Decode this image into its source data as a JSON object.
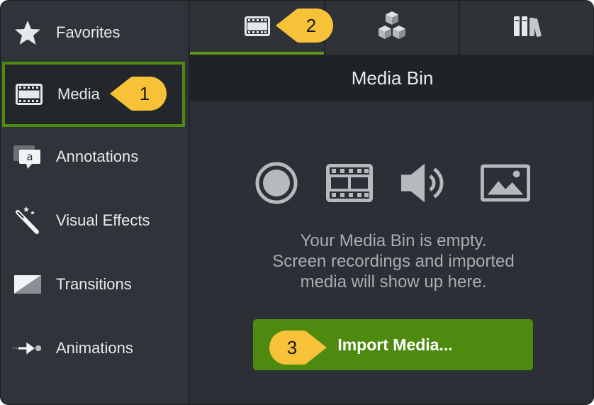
{
  "sidebar": {
    "items": [
      {
        "label": "Favorites",
        "icon": "star-icon"
      },
      {
        "label": "Media",
        "icon": "film-icon",
        "selected": true
      },
      {
        "label": "Annotations",
        "icon": "annotation-bubble-icon"
      },
      {
        "label": "Visual Effects",
        "icon": "magic-wand-icon"
      },
      {
        "label": "Transitions",
        "icon": "transition-icon"
      },
      {
        "label": "Animations",
        "icon": "animation-arrow-icon"
      }
    ]
  },
  "tabs": [
    {
      "icon": "film-icon",
      "active": true
    },
    {
      "icon": "cubes-icon",
      "active": false
    },
    {
      "icon": "library-books-icon",
      "active": false
    }
  ],
  "panel": {
    "title": "Media Bin",
    "empty_line1": "Your Media Bin is empty.",
    "empty_line2": "Screen recordings and imported",
    "empty_line3": "media will show up here.",
    "media_type_icons": [
      "record-circle-icon",
      "film-icon",
      "audio-speaker-icon",
      "image-icon"
    ],
    "import_button_label": "Import Media..."
  },
  "callouts": [
    {
      "number": "1",
      "target": "Media"
    },
    {
      "number": "2",
      "target": "media-tab"
    },
    {
      "number": "3",
      "target": "Import Media..."
    }
  ],
  "colors": {
    "accent_green": "#4f8a10",
    "callout_yellow": "#f7c238",
    "sidebar_bg": "#30343a",
    "panel_bg": "#2c3036",
    "header_bg": "#1f2226"
  }
}
